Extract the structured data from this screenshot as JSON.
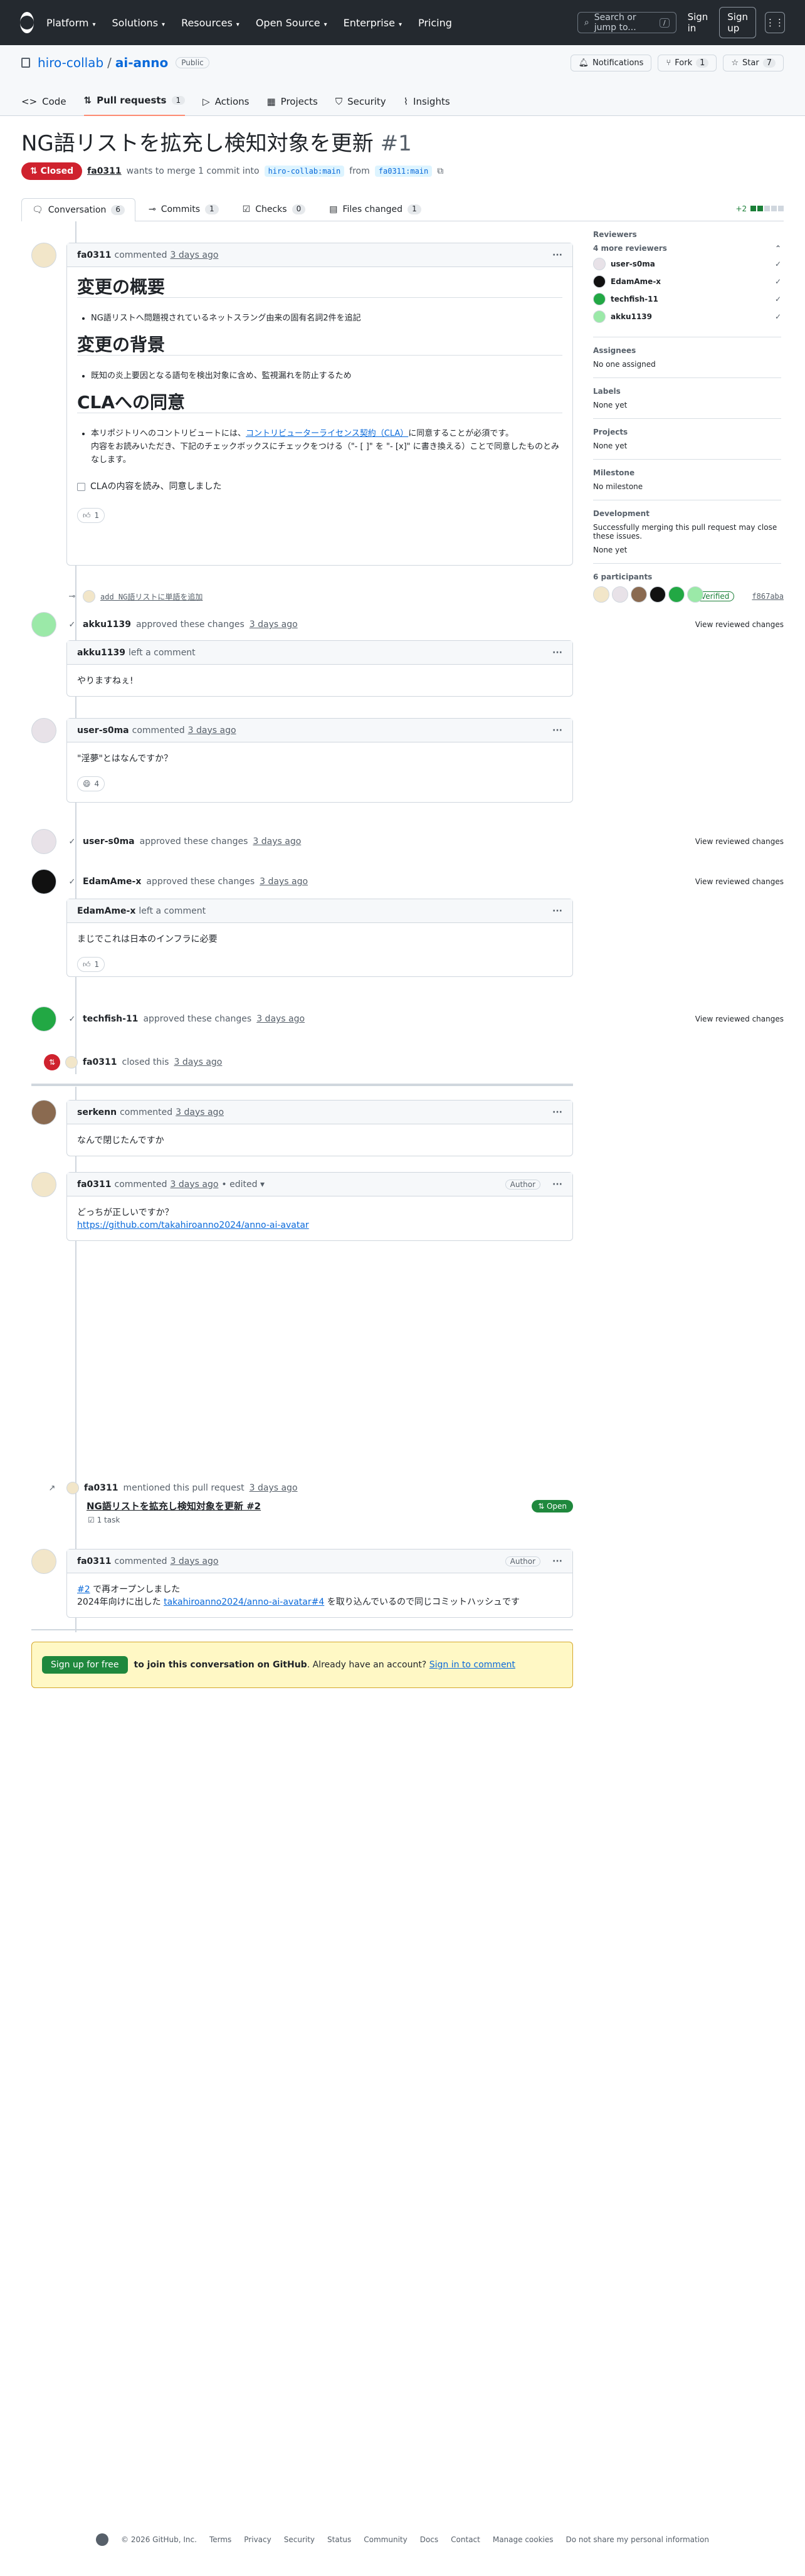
{
  "header": {
    "nav": [
      "Platform",
      "Solutions",
      "Resources",
      "Open Source",
      "Enterprise",
      "Pricing"
    ],
    "search_placeholder": "Search or jump to...",
    "search_key": "/",
    "sign_in": "Sign in",
    "sign_up": "Sign up"
  },
  "repo": {
    "owner": "hiro-collab",
    "sep": "/",
    "name": "ai-anno",
    "visibility": "Public",
    "notifications": "Notifications",
    "fork_label": "Fork",
    "fork_count": "1",
    "star_label": "Star",
    "star_count": "7",
    "tabs": [
      {
        "label": "Code"
      },
      {
        "label": "Pull requests",
        "count": "1"
      },
      {
        "label": "Actions"
      },
      {
        "label": "Projects"
      },
      {
        "label": "Security"
      },
      {
        "label": "Insights"
      }
    ]
  },
  "pr": {
    "title": "NG語リストを拡充し検知対象を更新",
    "number": "#1",
    "state": "Closed",
    "author": "fa0311",
    "merge_text": "wants to merge 1 commit into",
    "base": "hiro-collab:main",
    "from": "from",
    "head": "fa0311:main",
    "tabs": [
      {
        "label": "Conversation",
        "count": "6"
      },
      {
        "label": "Commits",
        "count": "1"
      },
      {
        "label": "Checks",
        "count": "0"
      },
      {
        "label": "Files changed",
        "count": "1"
      }
    ],
    "diffstat": "+2"
  },
  "timeline": {
    "c1": {
      "author": "fa0311",
      "action": "commented",
      "time": "3 days ago",
      "h1": "変更の概要",
      "li1": "NG語リストへ問題視されているネットスラング由来の固有名詞2件を追記",
      "h2": "変更の背景",
      "li2": "既知の炎上要因となる語句を検出対象に含め、監視漏れを防止するため",
      "h3": "CLAへの同意",
      "li3a": "本リポジトリへのコントリビュートには、",
      "li3link": "コントリビューターライセンス契約（CLA）",
      "li3b": "に同意することが必須です。",
      "li3c": "内容をお読みいただき、下記のチェックボックスにチェックをつける（\"- [ ]\" を \"- [x]\" に書き換える）ことで同意したものとみなします。",
      "checkbox": "CLAの内容を読み、同意しました",
      "reaction": "1"
    },
    "commit": {
      "message": "add NG語リストに単語を追加",
      "verified": "Verified",
      "sha": "f867aba"
    },
    "e1": {
      "user": "akku1139",
      "text": "approved these changes",
      "time": "3 days ago",
      "link": "View reviewed changes"
    },
    "c2": {
      "author": "akku1139",
      "action": "left a comment",
      "body": "やりますねぇ!"
    },
    "c3": {
      "author": "user-s0ma",
      "action": "commented",
      "time": "3 days ago",
      "body": "\"淫夢\"とはなんですか？",
      "reaction": "4"
    },
    "e2": {
      "user": "user-s0ma",
      "text": "approved these changes",
      "time": "3 days ago",
      "link": "View reviewed changes"
    },
    "e3": {
      "user": "EdamAme-x",
      "text": "approved these changes",
      "time": "3 days ago",
      "link": "View reviewed changes"
    },
    "c4": {
      "author": "EdamAme-x",
      "action": "left a comment",
      "body": "まじでこれは日本のインフラに必要",
      "reaction": "1"
    },
    "e4": {
      "user": "techfish-11",
      "text": "approved these changes",
      "time": "3 days ago",
      "link": "View reviewed changes"
    },
    "closed": {
      "user": "fa0311",
      "text": "closed this",
      "time": "3 days ago"
    },
    "c5": {
      "author": "serkenn",
      "action": "commented",
      "time": "3 days ago",
      "body": "なんで閉じたんですか"
    },
    "c6": {
      "author": "fa0311",
      "action": "commented",
      "time": "3 days ago",
      "edited": "• edited",
      "badge": "Author",
      "body": "どっちが正しいですか？",
      "link": "https://github.com/takahiroanno2024/anno-ai-avatar"
    },
    "mention": {
      "user": "fa0311",
      "text": "mentioned this pull request",
      "time": "3 days ago",
      "title": "NG語リストを拡充し検知対象を更新 #2",
      "tasks": "1 task",
      "state": "Open"
    },
    "c7": {
      "author": "fa0311",
      "action": "commented",
      "time": "3 days ago",
      "badge": "Author",
      "ref": "#2",
      "l1": "で再オープンしました",
      "l2a": "2024年向けに出した",
      "l2link": "takahiroanno2024/anno-ai-avatar#4",
      "l2b": "を取り込んでいるので同じコミットハッシュです"
    },
    "cta": {
      "button": "Sign up for free",
      "bold": "to join this conversation on GitHub",
      "rest": ". Already have an account?",
      "link": "Sign in to comment"
    }
  },
  "sidebar": {
    "reviewers_h": "Reviewers",
    "more": "4 more reviewers",
    "reviewers": [
      "user-s0ma",
      "EdamAme-x",
      "techfish-11",
      "akku1139"
    ],
    "assignees_h": "Assignees",
    "assignees": "No one assigned",
    "labels_h": "Labels",
    "labels": "None yet",
    "projects_h": "Projects",
    "projects": "None yet",
    "milestone_h": "Milestone",
    "milestone": "No milestone",
    "dev_h": "Development",
    "dev": "Successfully merging this pull request may close these issues.",
    "dev2": "None yet",
    "participants_h": "6 participants"
  },
  "footer": [
    "© 2026 GitHub, Inc.",
    "Terms",
    "Privacy",
    "Security",
    "Status",
    "Community",
    "Docs",
    "Contact",
    "Manage cookies",
    "Do not share my personal information"
  ],
  "colors": {
    "closed": "#cf222e",
    "open": "#1f883d",
    "link": "#0969da"
  }
}
